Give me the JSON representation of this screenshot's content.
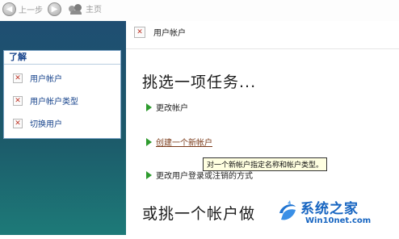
{
  "toolbar": {
    "back_label": "上一步",
    "home_label": "主页"
  },
  "left_pane": {
    "title": "了解",
    "items": [
      {
        "label": "用户帐户"
      },
      {
        "label": "用户帐户类型"
      },
      {
        "label": "切换用户"
      }
    ]
  },
  "main": {
    "title": "用户帐户",
    "heading": "挑选一项任务...",
    "tasks": [
      {
        "label": "更改帐户"
      },
      {
        "label": "创建一个新帐户"
      },
      {
        "label": "更改用户登录或注销的方式"
      }
    ],
    "tooltip": "对一个新帐户指定名称和帐户类型。",
    "subheading": "或挑一个帐户做"
  },
  "watermark": {
    "brand": "系统之家",
    "site": "Win10net.com"
  },
  "colors": {
    "left_pane_top": "#1f4e72",
    "left_pane_bottom": "#1d7a78",
    "task_arrow": "#2e9b2e",
    "link": "#7b3b1a",
    "tooltip_bg": "#ffffe1",
    "watermark": "#1765c1"
  },
  "icons": {
    "back": "back-arrow-icon",
    "forward": "forward-arrow-icon",
    "home": "users-home-icon",
    "item": "broken-image-icon",
    "task": "green-arrow-icon"
  }
}
